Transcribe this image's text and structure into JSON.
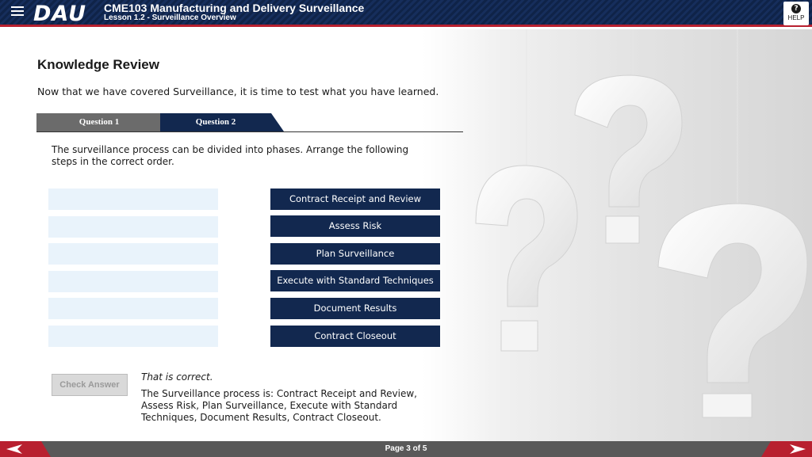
{
  "header": {
    "logo": "DAU",
    "course_title": "CME103 Manufacturing and Delivery Surveillance",
    "lesson_title": "Lesson 1.2 - Surveillance Overview",
    "help_label": "HELP"
  },
  "main": {
    "heading": "Knowledge Review",
    "intro": "Now that we have covered Surveillance, it is time to test what you have learned.",
    "tabs": [
      {
        "label": "Question 1"
      },
      {
        "label": "Question 2"
      }
    ],
    "prompt": "The surveillance process can be divided into phases. Arrange the following steps in the correct order.",
    "steps": [
      {
        "label": "Contract Receipt and Review"
      },
      {
        "label": "Assess Risk"
      },
      {
        "label": "Plan Surveillance"
      },
      {
        "label": "Execute with Standard Techniques"
      },
      {
        "label": "Document Results"
      },
      {
        "label": "Contract Closeout"
      }
    ],
    "check_button": "Check Answer",
    "feedback_title": "That is correct.",
    "feedback_body": "The Surveillance process is: Contract Receipt and Review, Assess Risk, Plan Surveillance, Execute with Standard Techniques, Document Results, Contract Closeout."
  },
  "footer": {
    "page_indicator": "Page 3 of 5"
  },
  "colors": {
    "header_navy": "#12284f",
    "accent_red": "#b8202f",
    "button_navy": "#12284f",
    "drop_slot": "#e9f3fb",
    "footer_gray": "#595959"
  },
  "icons": {
    "menu": "hamburger-icon",
    "help": "question-circle-icon",
    "prev": "arrow-left-icon",
    "next": "arrow-right-icon"
  }
}
